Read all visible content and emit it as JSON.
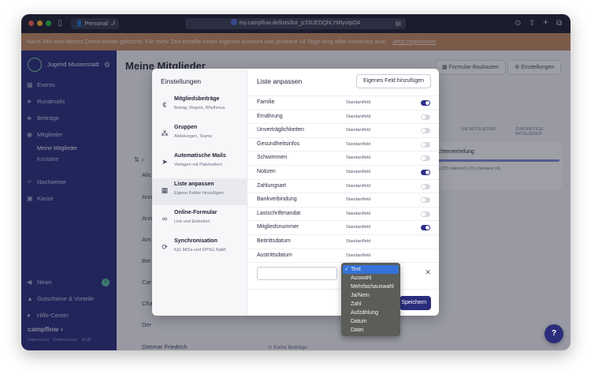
{
  "browser": {
    "profile": "Personal",
    "url": "my.campflow.de/lists/list_jz33UEDQhLYMtyvtpOA"
  },
  "banner": {
    "text": "Nach 24h wird dieses Demo-Konto gelöscht. Für mehr Zeit erstelle einen eigenen Account und probiere 14 Tage lang alles kostenlos aus!",
    "link": "Jetzt registrieren"
  },
  "sidebar": {
    "org_name": "Jugend Musterstadt",
    "items": [
      {
        "label": "Events",
        "icon": "calendar-icon"
      },
      {
        "label": "Rundmails",
        "icon": "send-icon"
      },
      {
        "label": "Beiträge",
        "icon": "tag-icon"
      },
      {
        "label": "Mitglieder",
        "icon": "users-icon"
      },
      {
        "label": "Nachweise",
        "icon": "sparkle-icon"
      },
      {
        "label": "Kasse",
        "icon": "register-icon"
      }
    ],
    "sub_items": [
      "Meine Mitglieder",
      "Kontakte"
    ],
    "bottom_items": [
      {
        "label": "News",
        "icon": "megaphone-icon",
        "badge": "0"
      },
      {
        "label": "Gutscheine & Vorteile",
        "icon": "thumbs-up-icon"
      },
      {
        "label": "Hilfe-Center",
        "icon": "help-icon"
      }
    ],
    "brand": "campflow",
    "footer_links": [
      "Impressum",
      "Datenschutz",
      "AGB"
    ]
  },
  "main": {
    "title": "Meine Mitglieder",
    "buttons": {
      "form_builder": "Formular-Baukasten",
      "settings": "Einstellungen"
    },
    "tabs": [
      "IVE MITGLIEDER",
      "ZUKÜNFTIGE MITGLIEDER"
    ],
    "card_title": "echterverteilung",
    "card_legend": "ch (20)   männlich (21)   montane (4)",
    "members": [
      "Alic",
      "Ann",
      "Ann",
      "Arn",
      "Bet",
      "Car",
      "Cha",
      "Der",
      "Dietmar Friedrich"
    ],
    "last_member_side": "Keine Beiträge"
  },
  "modal": {
    "left_title": "Einstellungen",
    "settings_items": [
      {
        "title": "Mitgliedsbeiträge",
        "subtitle": "Betrag, Regeln, Rhythmus",
        "icon": "euro-icon"
      },
      {
        "title": "Gruppen",
        "subtitle": "Abteilungen, Teams",
        "icon": "groups-icon"
      },
      {
        "title": "Automatische Mails",
        "subtitle": "Vorlagen mit Platzhaltern",
        "icon": "send-icon"
      },
      {
        "title": "Liste anpassen",
        "subtitle": "Eigene Felder hinzufügen",
        "icon": "table-icon"
      },
      {
        "title": "Online-Formular",
        "subtitle": "Link und Einbetten",
        "icon": "link-icon"
      },
      {
        "title": "Synchronisation",
        "subtitle": "KjG MiDa und DPSG NaMi",
        "icon": "sync-icon"
      }
    ],
    "right_title": "Liste anpassen",
    "add_field_button": "Eigenes Feld hinzufügen",
    "fields": [
      {
        "label": "Familie",
        "type": "Standardfeld",
        "toggle": true
      },
      {
        "label": "Ernährung",
        "type": "Standardfeld",
        "toggle": false
      },
      {
        "label": "Unverträglichkeiten",
        "type": "Standardfeld",
        "toggle": false
      },
      {
        "label": "Gesundheitsinfos",
        "type": "Standardfeld",
        "toggle": false
      },
      {
        "label": "Schwimmen",
        "type": "Standardfeld",
        "toggle": false
      },
      {
        "label": "Notizen",
        "type": "Standardfeld",
        "toggle": true
      },
      {
        "label": "Zahlungsart",
        "type": "Standardfeld",
        "toggle": false
      },
      {
        "label": "Bankverbindung",
        "type": "Standardfeld",
        "toggle": false
      },
      {
        "label": "Lastschriftmandat",
        "type": "Standardfeld",
        "toggle": false
      },
      {
        "label": "Mitgliedsnummer",
        "type": "Standardfeld",
        "toggle": true
      },
      {
        "label": "Beitrittsdatum",
        "type": "Standardfeld",
        "toggle": null
      },
      {
        "label": "Austrittsdatum",
        "type": "Standardfeld",
        "toggle": null
      }
    ],
    "new_field_value": "",
    "save_button": "Speichern"
  },
  "dropdown": {
    "selected": "Text",
    "options": [
      "Text",
      "Auswahl",
      "Mehrfachauswahl",
      "Ja/Nein",
      "Zahl",
      "Aufzählung",
      "Datum",
      "Datei"
    ]
  },
  "colors": {
    "brand": "#2a2d7c",
    "banner": "#c38a61",
    "toggle_on": "#2c2f86",
    "selected_option": "#3572d9"
  }
}
